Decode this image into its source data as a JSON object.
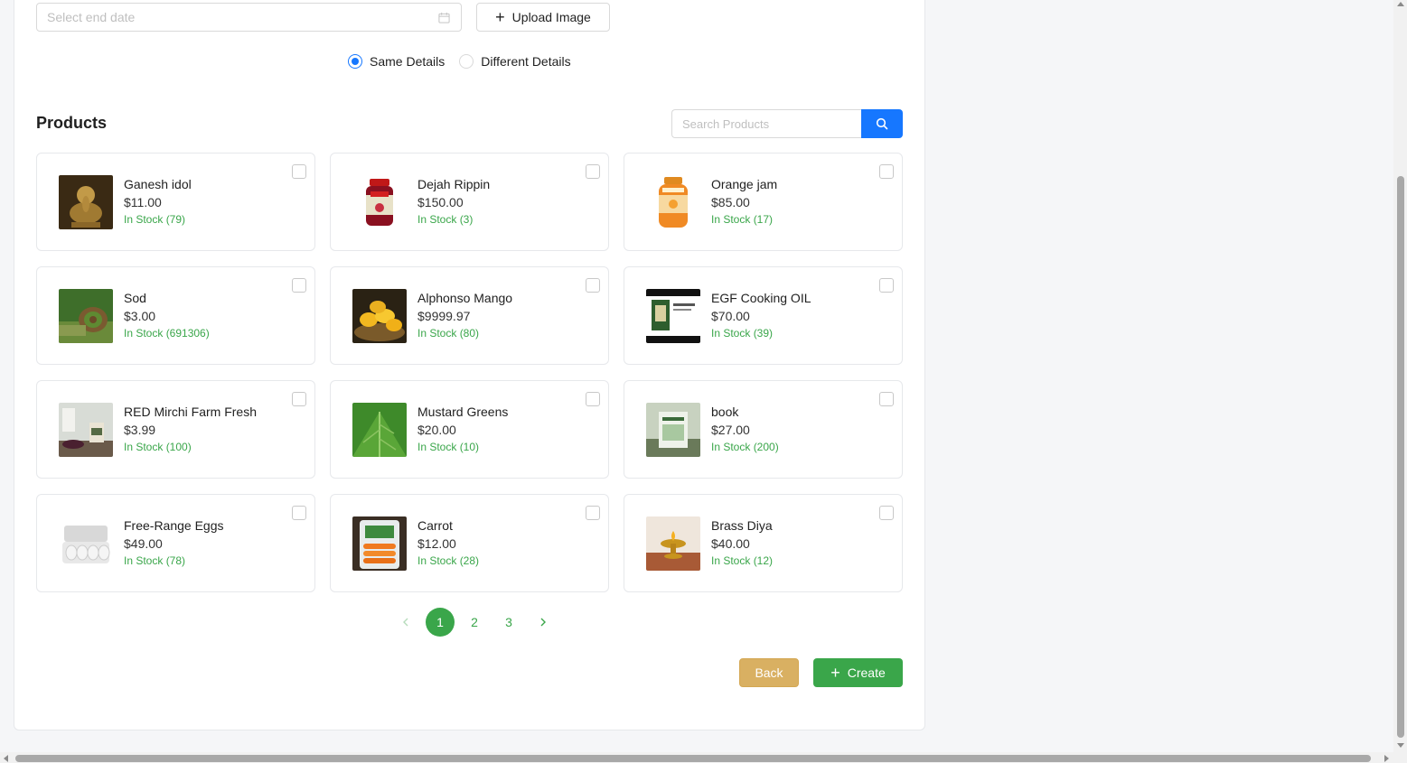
{
  "form": {
    "end_date_placeholder": "Select end date",
    "upload_label": "Upload Image",
    "radio_same": "Same Details",
    "radio_different": "Different Details",
    "radio_selected": "same"
  },
  "products": {
    "title": "Products",
    "search_placeholder": "Search Products",
    "items": [
      {
        "name": "Ganesh idol",
        "price": "$11.00",
        "stock": "In Stock (79)",
        "icon": "ganesh-idol-image"
      },
      {
        "name": "Dejah Rippin",
        "price": "$150.00",
        "stock": "In Stock (3)",
        "icon": "jam-jar-image"
      },
      {
        "name": "Orange jam",
        "price": "$85.00",
        "stock": "In Stock (17)",
        "icon": "orange-jam-image"
      },
      {
        "name": "Sod",
        "price": "$3.00",
        "stock": "In Stock (691306)",
        "icon": "sod-roll-image"
      },
      {
        "name": "Alphonso Mango",
        "price": "$9999.97",
        "stock": "In Stock (80)",
        "icon": "mango-basket-image"
      },
      {
        "name": "EGF Cooking OIL",
        "price": "$70.00",
        "stock": "In Stock (39)",
        "icon": "oil-tin-image"
      },
      {
        "name": "RED Mirchi Farm Fresh",
        "price": "$3.99",
        "stock": "In Stock (100)",
        "icon": "mirchi-pack-image"
      },
      {
        "name": "Mustard Greens",
        "price": "$20.00",
        "stock": "In Stock (10)",
        "icon": "greens-leaf-image"
      },
      {
        "name": "book",
        "price": "$27.00",
        "stock": "In Stock (200)",
        "icon": "book-cover-image"
      },
      {
        "name": "Free-Range Eggs",
        "price": "$49.00",
        "stock": "In Stock (78)",
        "icon": "egg-carton-image"
      },
      {
        "name": "Carrot",
        "price": "$12.00",
        "stock": "In Stock (28)",
        "icon": "carrot-bag-image"
      },
      {
        "name": "Brass Diya",
        "price": "$40.00",
        "stock": "In Stock (12)",
        "icon": "brass-diya-image"
      }
    ]
  },
  "pagination": {
    "pages": [
      "1",
      "2",
      "3"
    ],
    "current": "1"
  },
  "actions": {
    "back_label": "Back",
    "create_label": "Create"
  },
  "colors": {
    "primary": "#1677ff",
    "success": "#3aa64a",
    "back": "#d9b062"
  }
}
